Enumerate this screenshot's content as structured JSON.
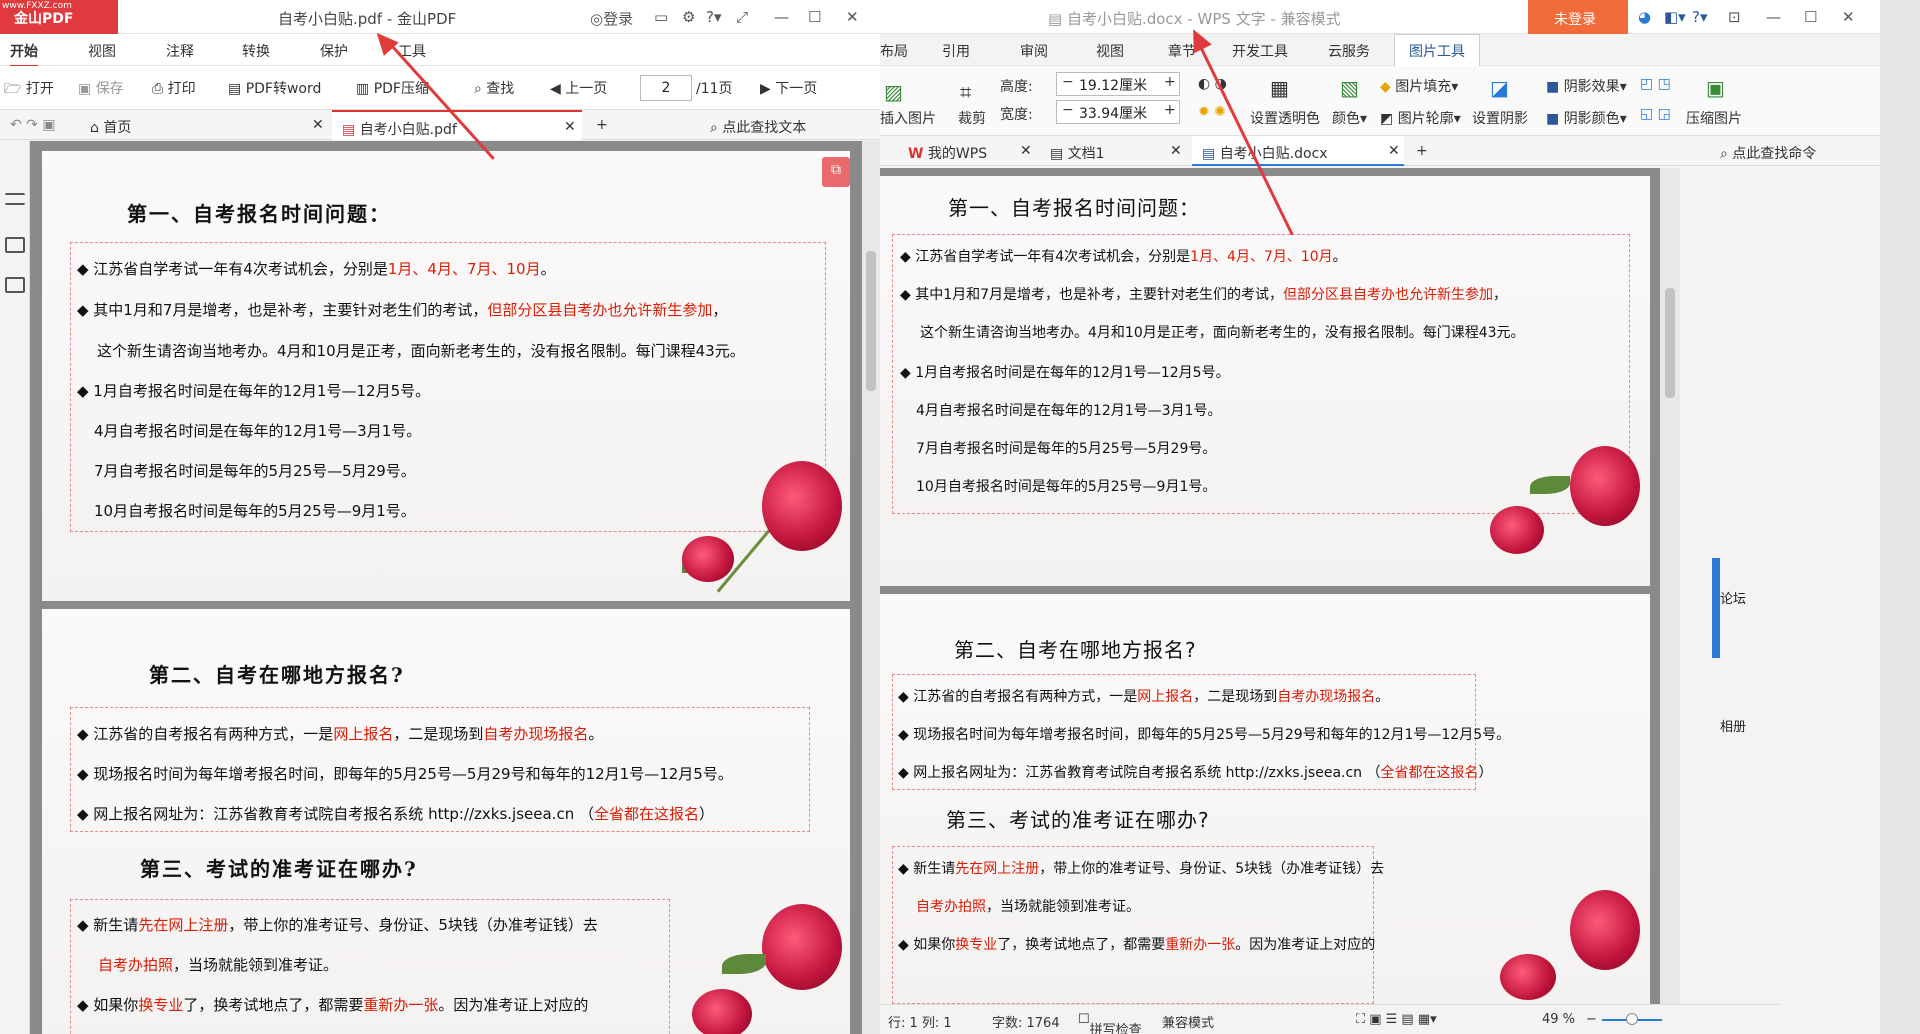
{
  "watermark": "www.FXXZ.com",
  "pdf": {
    "logo": "金山PDF",
    "title": "自考小白贴.pdf - 金山PDF",
    "login": "登录",
    "menus": [
      "开始",
      "视图",
      "注释",
      "转换",
      "保护",
      "工具"
    ],
    "toolbar": {
      "open": "打开",
      "save": "保存",
      "print": "打印",
      "to_word": "PDF转word",
      "compress": "PDF压缩",
      "find": "查找",
      "prev": "上一页",
      "page_value": "2",
      "page_total": "/11页",
      "next": "下一页"
    },
    "tabs": {
      "home": "首页",
      "doc": "自考小白贴.pdf",
      "search": "点此查找文本"
    },
    "page1": {
      "heading": "第一、自考报名时间问题：",
      "l1a": "◆ 江苏省自学考试一年有4次考试机会，分别是",
      "l1b": "1月、4月、7月、10月",
      "l2a": "◆ 其中1月和7月是增考，也是补考，主要针对老生们的考试，",
      "l2b": "但部分区县自考办也允许新生参加",
      "l3": "这个新生请咨询当地考办。4月和10月是正考，面向新老考生的，没有报名限制。每门课程43元。",
      "l4": "◆ 1月自考报名时间是在每年的12月1号—12月5号。",
      "l5": "4月自考报名时间是在每年的12月1号—3月1号。",
      "l6": "7月自考报名时间是每年的5月25号—5月29号。",
      "l7": "10月自考报名时间是每年的5月25号—9月1号。"
    },
    "page2": {
      "heading2": "第二、自考在哪地方报名?",
      "m1a": "◆ 江苏省的自考报名有两种方式，一是",
      "m1b": "网上报名",
      "m1c": "，二是现场到",
      "m1d": "自考办现场报名",
      "m2": "◆ 现场报名时间为每年增考报名时间，即每年的5月25号—5月29号和每年的12月1号—12月5号。",
      "m3a": "◆ 网上报名网址为：江苏省教育考试院自考报名系统 http://zxks.jseea.cn （",
      "m3b": "全省都在这报名",
      "m3c": "）",
      "heading3": "第三、考试的准考证在哪办?",
      "n1a": "◆ 新生请",
      "n1b": "先在网上注册",
      "n1c": "，带上你的准考证号、身份证、5块钱（办准考证钱）去",
      "n2a": "自考办拍照",
      "n2b": "，当场就能领到准考证。",
      "n3a": "◆ 如果你",
      "n3b": "换专业",
      "n3c": "了，换考试地点了，都需要",
      "n3d": "重新办一张",
      "n3e": "。因为准考证上对应的"
    }
  },
  "wps": {
    "title": "自考小白贴.docx - WPS 文字 - 兼容模式",
    "login": "未登录",
    "menus": [
      "布局",
      "引用",
      "审阅",
      "视图",
      "章节",
      "开发工具",
      "云服务",
      "图片工具"
    ],
    "ribbon": {
      "insert_pic": "插入图片",
      "crop": "裁剪",
      "height_label": "高度:",
      "height_value": "19.12厘米",
      "width_label": "宽度:",
      "width_value": "33.94厘米",
      "transparent": "设置透明色",
      "color": "颜色",
      "fill": "图片填充",
      "outline": "图片轮廓",
      "shadow": "设置阴影",
      "shadow_effect": "阴影效果",
      "shadow_color": "阴影颜色",
      "compress": "压缩图片"
    },
    "tabs": {
      "mywps": "我的WPS",
      "doc1": "文档1",
      "doc": "自考小白贴.docx",
      "search": "点此查找命令"
    },
    "status": {
      "pos": "行: 1 列: 1",
      "words": "字数: 1764",
      "spell": "拼写检查",
      "mode": "兼容模式",
      "zoom": "49 %"
    },
    "edge_a": "论坛",
    "edge_b": "相册"
  },
  "colors": {
    "accent_red": "#d81e06",
    "arrow": "#e03a3a",
    "wps_orange": "#f26b3a",
    "wps_blue": "#2b5797"
  }
}
